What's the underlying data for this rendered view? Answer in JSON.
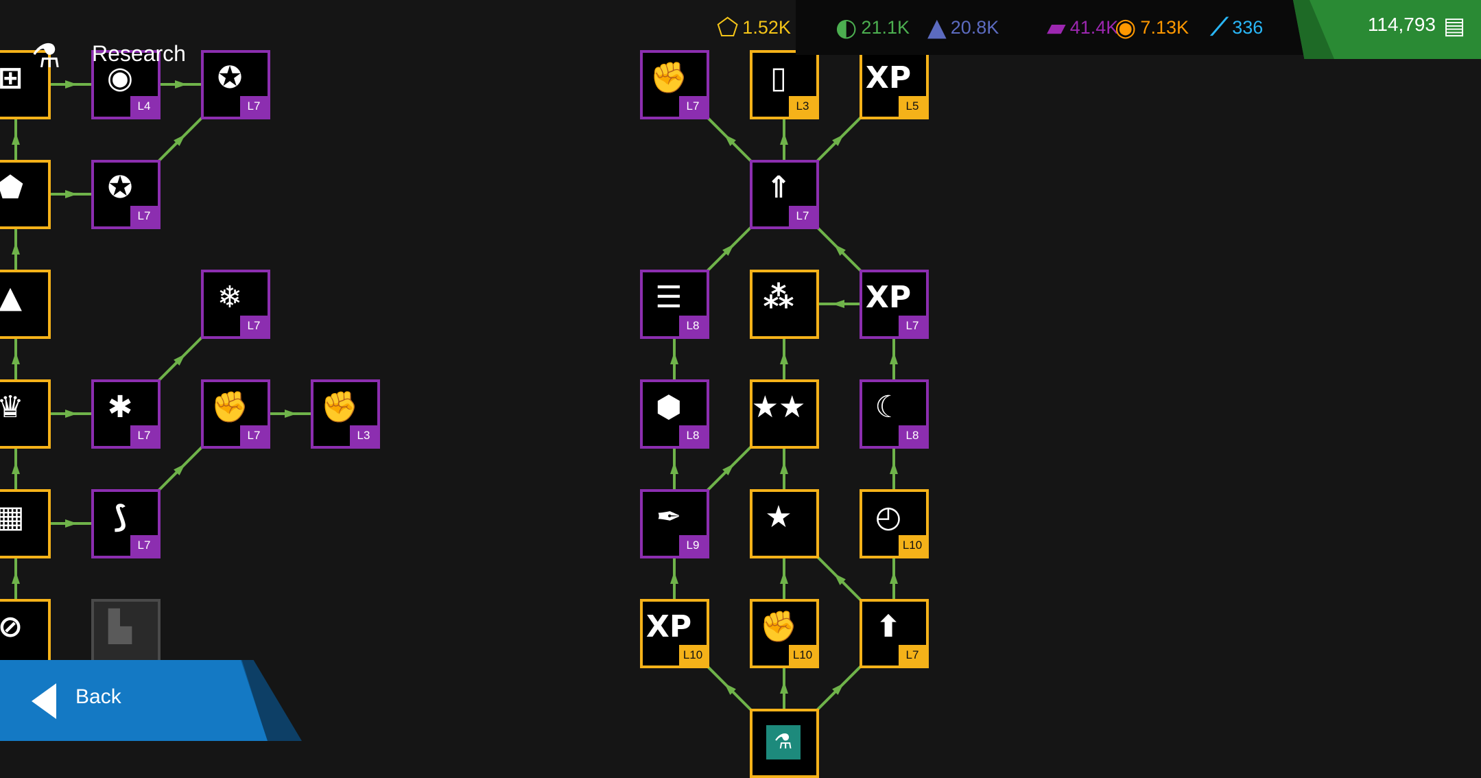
{
  "header": {
    "title": "Research",
    "title_icon": "flask-icon"
  },
  "resources": [
    {
      "name": "resource-1",
      "icon": "gold-crystal-icon",
      "glyph": "⬠",
      "value": "1.52K",
      "color": "#f5c518"
    },
    {
      "name": "resource-2",
      "icon": "green-wing-icon",
      "glyph": "◐",
      "value": "21.1K",
      "color": "#4caf50"
    },
    {
      "name": "resource-3",
      "icon": "blue-triangle-icon",
      "glyph": "▲",
      "value": "20.8K",
      "color": "#5c6bc0"
    },
    {
      "name": "resource-4",
      "icon": "purple-stripes-icon",
      "glyph": "▰",
      "value": "41.4K",
      "color": "#9c27b0"
    },
    {
      "name": "resource-5",
      "icon": "orange-swirl-icon",
      "glyph": "◉",
      "value": "7.13K",
      "color": "#ff9800"
    },
    {
      "name": "resource-6",
      "icon": "cyan-shards-icon",
      "glyph": "⟋",
      "value": "336",
      "color": "#29b6f6"
    }
  ],
  "credits": {
    "value": "114,793",
    "icon": "credits-cards-icon",
    "glyph": "▤"
  },
  "back_button": {
    "label": "Back",
    "icon": "back-arrow-icon"
  },
  "nodes": [
    {
      "id": "n-a1",
      "icon": "hierarchy-icon",
      "glyph": "⊞",
      "level": "",
      "color": "gold"
    },
    {
      "id": "n-a2",
      "icon": "eye-upgrade-icon",
      "glyph": "◉",
      "level": "L4",
      "color": "purple"
    },
    {
      "id": "n-a3",
      "icon": "vortex-defense-icon",
      "glyph": "✪",
      "level": "L7",
      "color": "purple"
    },
    {
      "id": "n-b1",
      "icon": "shards-up-icon",
      "glyph": "⬟",
      "level": "",
      "color": "gold"
    },
    {
      "id": "n-b2",
      "icon": "vortex-icon",
      "glyph": "✪",
      "level": "L7",
      "color": "purple"
    },
    {
      "id": "n-c1",
      "icon": "mountain-icon",
      "glyph": "▲",
      "level": "",
      "color": "gold"
    },
    {
      "id": "n-c2",
      "icon": "freeze-icon",
      "glyph": "❄",
      "level": "L7",
      "color": "purple"
    },
    {
      "id": "n-d1",
      "icon": "crown-icon",
      "glyph": "♛",
      "level": "",
      "color": "gold"
    },
    {
      "id": "n-d2",
      "icon": "snow-wind-icon",
      "glyph": "✱",
      "level": "L7",
      "color": "purple"
    },
    {
      "id": "n-d3",
      "icon": "fist-icon",
      "glyph": "✊",
      "level": "L7",
      "color": "purple"
    },
    {
      "id": "n-d4",
      "icon": "fire-fist-icon",
      "glyph": "✊",
      "level": "L3",
      "color": "purple"
    },
    {
      "id": "n-e1",
      "icon": "bars-icon",
      "glyph": "▦",
      "level": "",
      "color": "gold"
    },
    {
      "id": "n-e2",
      "icon": "claw-icon",
      "glyph": "⟆",
      "level": "L7",
      "color": "purple"
    },
    {
      "id": "n-f1",
      "icon": "split-icon",
      "glyph": "⊘",
      "level": "",
      "color": "gold"
    },
    {
      "id": "n-f2",
      "icon": "factory-locked-icon",
      "glyph": "▙",
      "level": "",
      "color": "locked"
    },
    {
      "id": "m-r1a",
      "icon": "fist-strike-icon",
      "glyph": "✊",
      "level": "L7",
      "color": "purple"
    },
    {
      "id": "m-r1b",
      "icon": "glass-icon",
      "glyph": "▯",
      "level": "L3",
      "color": "gold"
    },
    {
      "id": "m-r1c",
      "icon": "xp-clock-icon",
      "glyph": "XP",
      "level": "L5",
      "color": "gold"
    },
    {
      "id": "m-r2",
      "icon": "ascend-icon",
      "glyph": "⇑",
      "level": "L7",
      "color": "purple"
    },
    {
      "id": "m-r3a",
      "icon": "list-bolt-icon",
      "glyph": "☰",
      "level": "L8",
      "color": "purple"
    },
    {
      "id": "m-r3b",
      "icon": "three-stars-icon",
      "glyph": "⁂",
      "level": "",
      "color": "gold"
    },
    {
      "id": "m-r3c",
      "icon": "xp-plus-icon",
      "glyph": "XP",
      "level": "L7",
      "color": "purple"
    },
    {
      "id": "m-r4a",
      "icon": "shield-head-icon",
      "glyph": "⬢",
      "level": "L8",
      "color": "purple"
    },
    {
      "id": "m-r4b",
      "icon": "two-stars-icon",
      "glyph": "★★",
      "level": "",
      "color": "gold"
    },
    {
      "id": "m-r4c",
      "icon": "crescent-timer-icon",
      "glyph": "☾",
      "level": "L8",
      "color": "purple"
    },
    {
      "id": "m-r5a",
      "icon": "pen-nib-icon",
      "glyph": "✒",
      "level": "L9",
      "color": "purple"
    },
    {
      "id": "m-r5b",
      "icon": "star-icon",
      "glyph": "★",
      "level": "",
      "color": "gold"
    },
    {
      "id": "m-r5c",
      "icon": "clock-shards-icon",
      "glyph": "◴",
      "level": "L10",
      "color": "gold"
    },
    {
      "id": "m-r6a",
      "icon": "max-xp-icon",
      "glyph": "XP",
      "level": "L10",
      "color": "gold"
    },
    {
      "id": "m-r6b",
      "icon": "fist-icon",
      "glyph": "✊",
      "level": "L10",
      "color": "gold"
    },
    {
      "id": "m-r6c",
      "icon": "arrow-up-icon",
      "glyph": "⬆",
      "level": "L7",
      "color": "gold"
    },
    {
      "id": "m-r7",
      "icon": "root-research-icon",
      "glyph": "⚗",
      "level": "",
      "color": "teal"
    }
  ],
  "links": [
    [
      "n-a1",
      "n-a2"
    ],
    [
      "n-a2",
      "n-a3"
    ],
    [
      "n-b1",
      "n-b2"
    ],
    [
      "n-b2",
      "n-a3"
    ],
    [
      "n-d1",
      "n-d2"
    ],
    [
      "n-d2",
      "n-c2"
    ],
    [
      "n-d3",
      "n-d4"
    ],
    [
      "n-e1",
      "n-e2"
    ],
    [
      "n-e2",
      "n-d3"
    ],
    [
      "n-f1",
      "n-e1"
    ],
    [
      "n-e1",
      "n-d1"
    ],
    [
      "n-d1",
      "n-c1"
    ],
    [
      "n-c1",
      "n-b1"
    ],
    [
      "n-b1",
      "n-a1"
    ],
    [
      "m-r7",
      "m-r6a"
    ],
    [
      "m-r7",
      "m-r6b"
    ],
    [
      "m-r7",
      "m-r6c"
    ],
    [
      "m-r6a",
      "m-r5a"
    ],
    [
      "m-r6b",
      "m-r5b"
    ],
    [
      "m-r6c",
      "m-r5c"
    ],
    [
      "m-r6c",
      "m-r5b"
    ],
    [
      "m-r5a",
      "m-r4a"
    ],
    [
      "m-r5a",
      "m-r4b"
    ],
    [
      "m-r5b",
      "m-r4b"
    ],
    [
      "m-r5c",
      "m-r4c"
    ],
    [
      "m-r4a",
      "m-r3a"
    ],
    [
      "m-r4b",
      "m-r3b"
    ],
    [
      "m-r4c",
      "m-r3c"
    ],
    [
      "m-r3c",
      "m-r3b"
    ],
    [
      "m-r3a",
      "m-r2"
    ],
    [
      "m-r3c",
      "m-r2"
    ],
    [
      "m-r2",
      "m-r1a"
    ],
    [
      "m-r2",
      "m-r1b"
    ],
    [
      "m-r2",
      "m-r1c"
    ]
  ]
}
